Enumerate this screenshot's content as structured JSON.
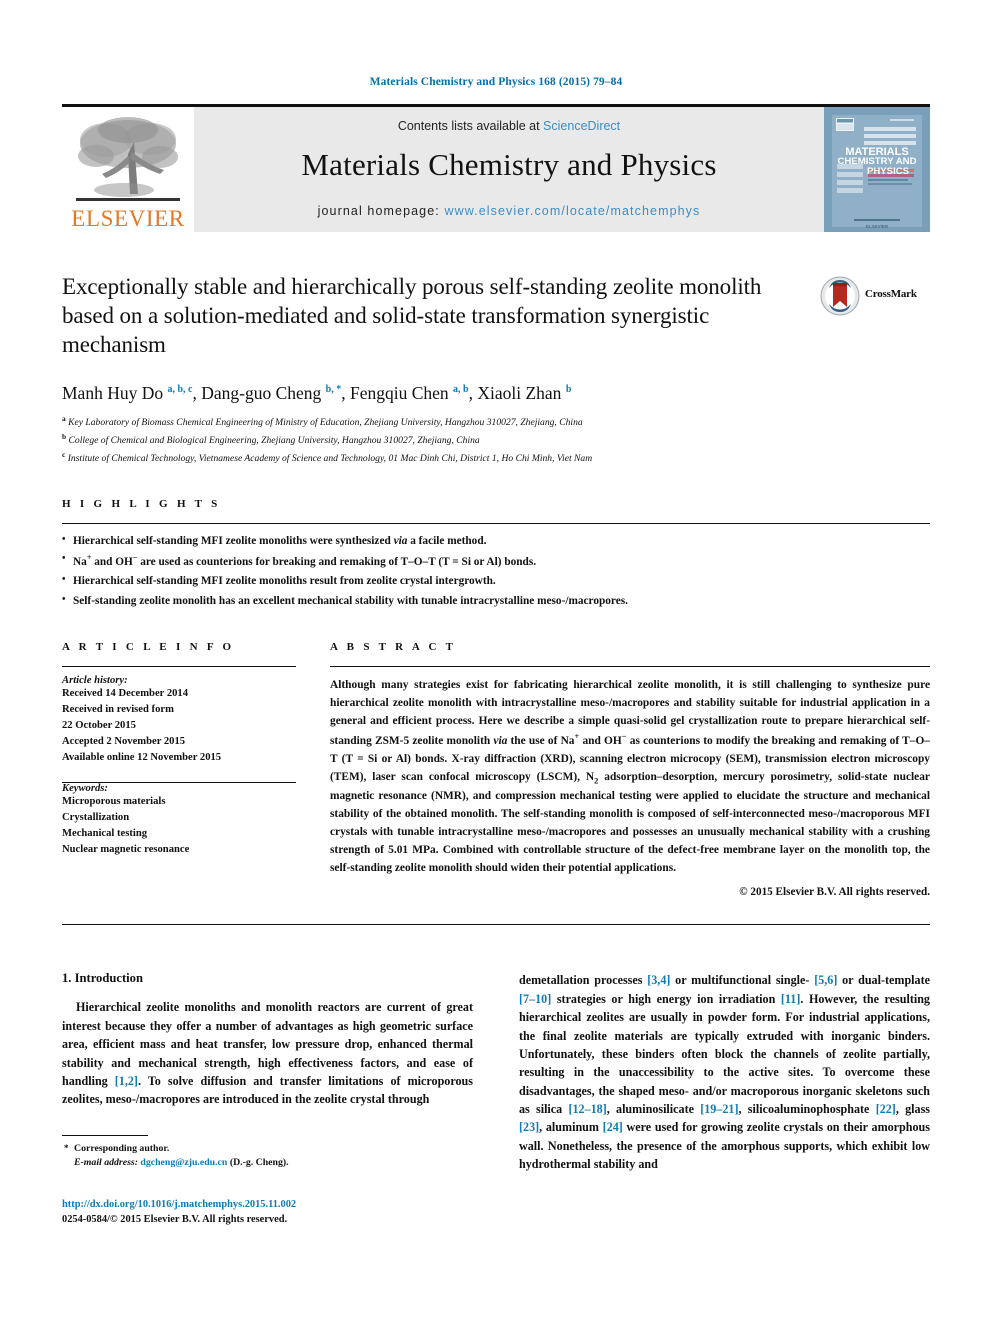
{
  "running_head": "Materials Chemistry and Physics 168 (2015) 79–84",
  "banner": {
    "publisher": "ELSEVIER",
    "contents_prefix": "Contents lists available at ",
    "contents_link": "ScienceDirect",
    "journal_title": "Materials Chemistry and Physics",
    "homepage_prefix": "journal homepage: ",
    "homepage_url": "www.elsevier.com/locate/matchemphys",
    "cover_title_line1": "MATERIALS",
    "cover_title_line2": "CHEMISTRY AND",
    "cover_title_line3": "PHYSICS"
  },
  "article": {
    "title": "Exceptionally stable and hierarchically porous self-standing zeolite monolith based on a solution-mediated and solid-state transformation synergistic mechanism",
    "crossmark_label": "CrossMark",
    "authors": [
      {
        "name": "Manh Huy Do",
        "marks": "a, b, c"
      },
      {
        "name": "Dang-guo Cheng",
        "marks": "b, *"
      },
      {
        "name": "Fengqiu Chen",
        "marks": "a, b"
      },
      {
        "name": "Xiaoli Zhan",
        "marks": "b"
      }
    ],
    "affiliations": [
      {
        "mark": "a",
        "text": "Key Laboratory of Biomass Chemical Engineering of Ministry of Education, Zhejiang University, Hangzhou 310027, Zhejiang, China"
      },
      {
        "mark": "b",
        "text": "College of Chemical and Biological Engineering, Zhejiang University, Hangzhou 310027, Zhejiang, China"
      },
      {
        "mark": "c",
        "text": "Institute of Chemical Technology, Vietnamese Academy of Science and Technology, 01 Mac Dinh Chi, District 1, Ho Chi Minh, Viet Nam"
      }
    ]
  },
  "highlights": {
    "heading": "H I G H L I G H T S",
    "items": [
      "Hierarchical self-standing MFI zeolite monoliths were synthesized via a facile method.",
      "Na+ and OH− are used as counterions for breaking and remaking of T–O–T (T = Si or Al) bonds.",
      "Hierarchical self-standing MFI zeolite monoliths result from zeolite crystal intergrowth.",
      "Self-standing zeolite monolith has an excellent mechanical stability with tunable intracrystalline meso-/macropores."
    ]
  },
  "article_info": {
    "heading": "A R T I C L E  I N F O",
    "history_label": "Article history:",
    "history": [
      "Received 14 December 2014",
      "Received in revised form",
      "22 October 2015",
      "Accepted 2 November 2015",
      "Available online 12 November 2015"
    ],
    "keywords_label": "Keywords:",
    "keywords": [
      "Microporous materials",
      "Crystallization",
      "Mechanical testing",
      "Nuclear magnetic resonance"
    ]
  },
  "abstract": {
    "heading": "A B S T R A C T",
    "text": "Although many strategies exist for fabricating hierarchical zeolite monolith, it is still challenging to synthesize pure hierarchical zeolite monolith with intracrystalline meso-/macropores and stability suitable for industrial application in a general and efficient process. Here we describe a simple quasi-solid gel crystallization route to prepare hierarchical self-standing ZSM-5 zeolite monolith via the use of Na+ and OH− as counterions to modify the breaking and remaking of T–O–T (T = Si or Al) bonds. X-ray diffraction (XRD), scanning electron microcopy (SEM), transmission electron microscopy (TEM), laser scan confocal microscopy (LSCM), N2 adsorption–desorption, mercury porosimetry, solid-state nuclear magnetic resonance (NMR), and compression mechanical testing were applied to elucidate the structure and mechanical stability of the obtained monolith. The self-standing monolith is composed of self-interconnected meso-/macroporous MFI crystals with tunable intracrystalline meso-/macropores and possesses an unusually mechanical stability with a crushing strength of 5.01 MPa. Combined with controllable structure of the defect-free membrane layer on the monolith top, the self-standing zeolite monolith should widen their potential applications.",
    "copyright": "© 2015 Elsevier B.V. All rights reserved."
  },
  "introduction": {
    "heading": "1. Introduction",
    "left_paragraph": "Hierarchical zeolite monoliths and monolith reactors are current of great interest because they offer a number of advantages as high geometric surface area, efficient mass and heat transfer, low pressure drop, enhanced thermal stability and mechanical strength, high effectiveness factors, and ease of handling [1,2]. To solve diffusion and transfer limitations of microporous zeolites, meso-/macropores are introduced in the zeolite crystal through",
    "right_paragraph": "demetallation processes [3,4] or multifunctional single- [5,6] or dual-template [7–10] strategies or high energy ion irradiation [11]. However, the resulting hierarchical zeolites are usually in powder form. For industrial applications, the final zeolite materials are typically extruded with inorganic binders. Unfortunately, these binders often block the channels of zeolite partially, resulting in the unaccessibility to the active sites. To overcome these disadvantages, the shaped meso- and/or macroporous inorganic skeletons such as silica [12–18], aluminosilicate [19–21], silicoaluminophosphate [22], glass [23], aluminum [24] were used for growing zeolite crystals on their amorphous wall. Nonetheless, the presence of the amorphous supports, which exhibit low hydrothermal stability and"
  },
  "footnote": {
    "corresponding": "Corresponding author.",
    "email_label": "E-mail address:",
    "email": "dgcheng@zju.edu.cn",
    "email_suffix": "(D.-g. Cheng)."
  },
  "footer": {
    "doi": "http://dx.doi.org/10.1016/j.matchemphys.2015.11.002",
    "issn_line": "0254-0584/© 2015 Elsevier B.V. All rights reserved."
  },
  "colors": {
    "link_blue": "#0f7ab3",
    "banner_gray": "#e9e9e9",
    "elsevier_orange": "#E87722",
    "cover_blue": "#7a9fba",
    "crossmark_red": "#b5291e"
  }
}
